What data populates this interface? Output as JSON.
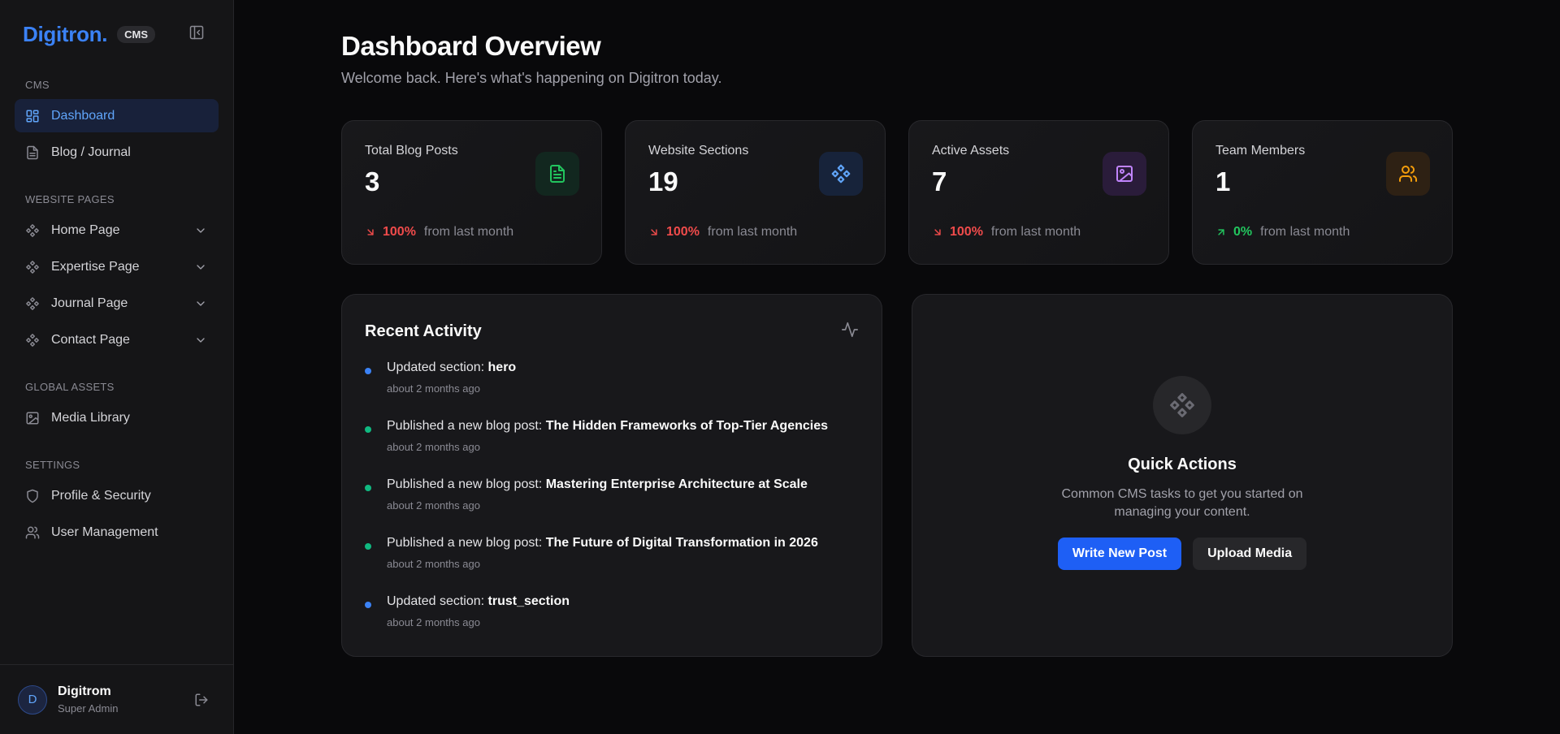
{
  "sidebar": {
    "brand": "Digitron.",
    "badge": "CMS",
    "groups": [
      {
        "title": "CMS",
        "items": [
          {
            "label": "Dashboard",
            "icon": "grid-icon",
            "active": true
          },
          {
            "label": "Blog / Journal",
            "icon": "file-icon"
          }
        ]
      },
      {
        "title": "WEBSITE PAGES",
        "items": [
          {
            "label": "Home Page",
            "icon": "component-icon",
            "expandable": true
          },
          {
            "label": "Expertise Page",
            "icon": "component-icon",
            "expandable": true
          },
          {
            "label": "Journal Page",
            "icon": "component-icon",
            "expandable": true
          },
          {
            "label": "Contact Page",
            "icon": "component-icon",
            "expandable": true
          }
        ]
      },
      {
        "title": "GLOBAL ASSETS",
        "items": [
          {
            "label": "Media Library",
            "icon": "image-icon"
          }
        ]
      },
      {
        "title": "SETTINGS",
        "items": [
          {
            "label": "Profile & Security",
            "icon": "shield-icon"
          },
          {
            "label": "User Management",
            "icon": "users-icon"
          }
        ]
      }
    ],
    "user": {
      "initial": "D",
      "name": "Digitrom",
      "role": "Super Admin"
    }
  },
  "header": {
    "title": "Dashboard Overview",
    "subtitle": "Welcome back. Here's what's happening on Digitron today."
  },
  "stats": [
    {
      "label": "Total Blog Posts",
      "value": "3",
      "change": "100%",
      "direction": "down",
      "suffix": "from last month",
      "icon": "file-text-icon",
      "color": "#22c55e"
    },
    {
      "label": "Website Sections",
      "value": "19",
      "change": "100%",
      "direction": "down",
      "suffix": "from last month",
      "icon": "component-icon",
      "color": "#60a5fa"
    },
    {
      "label": "Active Assets",
      "value": "7",
      "change": "100%",
      "direction": "down",
      "suffix": "from last month",
      "icon": "image-icon",
      "color": "#c084fc"
    },
    {
      "label": "Team Members",
      "value": "1",
      "change": "0%",
      "direction": "up",
      "suffix": "from last month",
      "icon": "users-icon",
      "color": "#f59e0b"
    }
  ],
  "activity": {
    "title": "Recent Activity",
    "items": [
      {
        "prefix": "Updated section: ",
        "subject": "hero",
        "time": "about 2 months ago",
        "color": "#3b82f6"
      },
      {
        "prefix": "Published a new blog post: ",
        "subject": "The Hidden Frameworks of Top-Tier Agencies",
        "time": "about 2 months ago",
        "color": "#10b981"
      },
      {
        "prefix": "Published a new blog post: ",
        "subject": "Mastering Enterprise Architecture at Scale",
        "time": "about 2 months ago",
        "color": "#10b981"
      },
      {
        "prefix": "Published a new blog post: ",
        "subject": "The Future of Digital Transformation in 2026",
        "time": "about 2 months ago",
        "color": "#10b981"
      },
      {
        "prefix": "Updated section: ",
        "subject": "trust_section",
        "time": "about 2 months ago",
        "color": "#3b82f6"
      }
    ]
  },
  "quick_actions": {
    "title": "Quick Actions",
    "description": "Common CMS tasks to get you started on managing your content.",
    "primary_label": "Write New Post",
    "secondary_label": "Upload Media"
  }
}
